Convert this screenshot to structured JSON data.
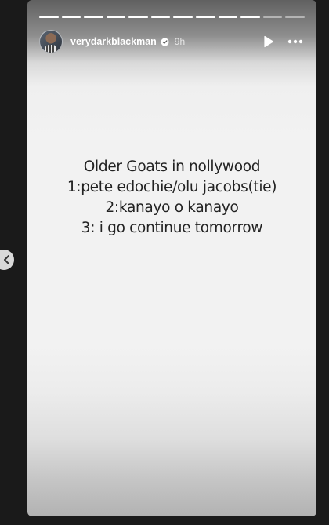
{
  "story": {
    "user": {
      "username": "verydarkblackman",
      "time_ago": "9h",
      "verified": true
    },
    "progress": {
      "segments": 12,
      "completed": 10
    },
    "content": {
      "lines": [
        "Older Goats in nollywood",
        "1:pete edochie/olu jacobs(tie)",
        "2:kanayo o kanayo",
        "3: i go continue tomorrow"
      ]
    },
    "controls": {
      "play_icon": "play-icon",
      "more_icon": "more-horizontal-icon",
      "prev_icon": "chevron-left-icon"
    },
    "colors": {
      "story_background": "#f2f2f2",
      "text": "#222222",
      "page_background": "#1a1a1a"
    }
  }
}
